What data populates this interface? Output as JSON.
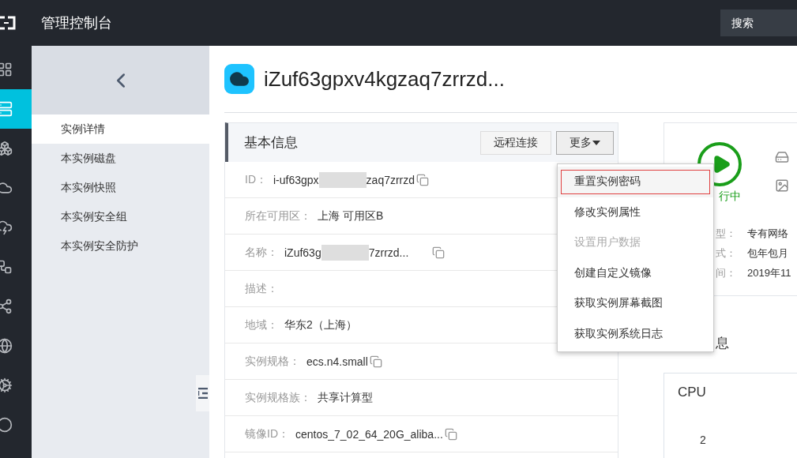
{
  "topbar": {
    "title": "管理控制台",
    "search": {
      "placeholder": "搜索"
    }
  },
  "rail": [
    {
      "kind": "grid",
      "selected": false
    },
    {
      "kind": "server",
      "selected": true
    },
    {
      "kind": "boxes",
      "selected": false
    },
    {
      "kind": "cloud",
      "selected": false
    },
    {
      "kind": "cloud-bolt",
      "selected": false
    },
    {
      "kind": "network",
      "selected": false
    },
    {
      "kind": "share",
      "selected": false
    },
    {
      "kind": "globe",
      "selected": false
    },
    {
      "kind": "gear",
      "selected": false
    },
    {
      "kind": "circle",
      "selected": false
    }
  ],
  "sidebar": {
    "items": [
      {
        "label": "实例详情",
        "selected": true
      },
      {
        "label": "本实例磁盘",
        "selected": false
      },
      {
        "label": "本实例快照",
        "selected": false
      },
      {
        "label": "本实例安全组",
        "selected": false
      },
      {
        "label": "本实例安全防护",
        "selected": false
      }
    ]
  },
  "instance": {
    "title": "iZuf63gpxv4kgzaq7zrrzd..."
  },
  "basic_info": {
    "title": "基本信息",
    "buttons": [
      {
        "label": "远程连接",
        "kind": "plain"
      },
      {
        "label": "更多",
        "kind": "dropdown",
        "expanded": true
      }
    ],
    "rows": [
      {
        "label": "ID：",
        "value": "i-uf63gpx",
        "value_after": "zaq7zrrzd",
        "copyable": true
      },
      {
        "label": "所在可用区：",
        "value": "上海 可用区B",
        "copyable": false
      },
      {
        "label": "名称：",
        "value": "iZuf63g",
        "value_after": "7zrrzd...",
        "copyable": true
      },
      {
        "label": "描述：",
        "copyable": false
      },
      {
        "label": "地域：",
        "value": "华东2（上海）",
        "copyable": false
      },
      {
        "label": "实例规格：",
        "value": "ecs.n4.small",
        "copyable": true
      },
      {
        "label": "实例规格族：",
        "value": "共享计算型",
        "copyable": false
      },
      {
        "label": "镜像ID：",
        "value": "centos_7_02_64_20G_aliba...",
        "copyable": true
      }
    ]
  },
  "more_menu": [
    {
      "label": "重置实例密码",
      "selected": true,
      "disabled": false
    },
    {
      "label": "修改实例属性",
      "selected": false,
      "disabled": false
    },
    {
      "label": "设置用户数据",
      "selected": false,
      "disabled": true
    },
    {
      "label": "创建自定义镜像",
      "selected": false,
      "disabled": false
    },
    {
      "label": "获取实例屏幕截图",
      "selected": false,
      "disabled": false
    },
    {
      "label": "获取实例系统日志",
      "selected": false,
      "disabled": false
    }
  ],
  "status": {
    "label": "行中",
    "running": true,
    "rows": [
      {
        "label": "型：",
        "value": "专有网络"
      },
      {
        "label": "式：",
        "value": "包年包月"
      },
      {
        "label": "间：",
        "value": "2019年11"
      }
    ]
  },
  "config": {
    "title": "息",
    "cards": [
      {
        "label": "CPU",
        "value": "2"
      }
    ]
  }
}
